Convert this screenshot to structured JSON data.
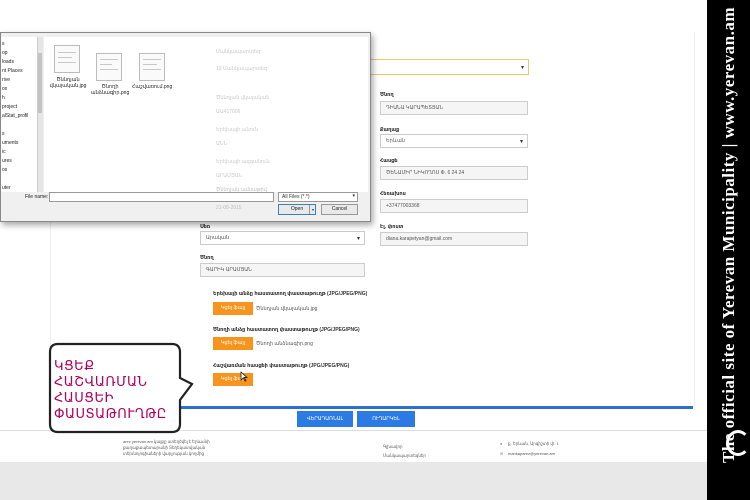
{
  "watermark": {
    "vertical_text": "The official site of Yerevan Municipality   |   www.yerevan.am"
  },
  "dialog": {
    "nav_items": [
      "s",
      "op",
      "loads",
      "nt Places",
      "rive",
      "ox",
      "h",
      "project",
      "alStat_profil",
      "",
      "s",
      "uments",
      "ic",
      "ures",
      "os",
      "",
      "uter"
    ],
    "files": [
      {
        "name": "Ծննդյան վկայական.jpg"
      },
      {
        "name": "Ծնողի անձնագիր.png"
      },
      {
        "name": "Հաշվառում.png"
      }
    ],
    "file_name_label": "File name:",
    "filter_value": "All Files (*.*)",
    "open_label": "Open",
    "cancel_label": "Cancel",
    "ghost_labels": [
      "Մանկապարտեզ",
      "13 Մանկապարտեզ",
      "Ծննդյան վկայական",
      "ԱԱ417006",
      "Երեխայի անուն",
      "ԱՆՆ",
      "Երեխայի ազգանուն",
      "ԱՐԱՄՅԱՆ",
      "Ծննդյան ամսաթիվ",
      "21-08-2015"
    ]
  },
  "form": {
    "top_select_value": "",
    "right_column": [
      {
        "label": "Ծնող",
        "value": "ԴԻԱՆԱ ԿԱՐԱՊԵՏՅԱՆ",
        "select": false
      },
      {
        "label": "Քաղաք",
        "value": "Երևան",
        "select": true
      },
      {
        "label": "Հասցե",
        "value": "ԾԵՆԱՄԻՐ ՆԻԿՈՂՈՍ Փ. 6 24 24",
        "select": false
      },
      {
        "label": "Հեռախոս",
        "value": "+37477003368",
        "select": false
      },
      {
        "label": "Էլ. փոստ",
        "value": "diana.karapetyan@gmail.com",
        "select": false
      }
    ],
    "left_column": [
      {
        "label": "Սեռ",
        "value": "Արական",
        "select": true
      },
      {
        "label": "Ծնող",
        "value": "ԳԱՐԻԿ ԱՐԱՄՅԱՆ",
        "select": false
      }
    ],
    "uploads": [
      {
        "label": "Երեխայի անձը հաստատող փաստաթուղթ (JPG/JPEG/PNG)",
        "button": "Կցել ֆայլ",
        "file": "Ծննդյան վկայական.jpg"
      },
      {
        "label": "Ծնողի անձը հաստատող փաստաթուղթ (JPG/JPEG/PNG)",
        "button": "Կցել ֆայլ",
        "file": "Ծնողի անձնագիր.png"
      },
      {
        "label": "Հաշվառման հասցեի փաստաթուղթ (JPG/JPEG/PNG)",
        "button": "Կցել ֆայլ",
        "file": ""
      }
    ]
  },
  "footer_buttons": {
    "back": "ՎԵՐԱԴԱՌՆԱԼ",
    "send": "ՈՒՂԱՐԿԵԼ"
  },
  "footer": {
    "left_lines": [
      "arez yerevan.am կայքը ստեղծվել է Երևանի",
      "քաղաքապետարանի Տեղեկատվական",
      "տեխնոլոգիաների վարչության կողմից"
    ],
    "middle_lines": [
      "Գլխավոր",
      "Մանկապարտեզներ"
    ],
    "address": "ք. Երևան, Արգիշտի փ. 1",
    "email": "mankaparez@yerevan.am"
  },
  "callout": {
    "lines": [
      "ԿՑԵՔ",
      "ՀԱՇՎԱՌՄԱՆ",
      "ՀԱՍՑԵԻ",
      "ՓԱՍՏԱԹՈՒՂԹԸ"
    ]
  }
}
